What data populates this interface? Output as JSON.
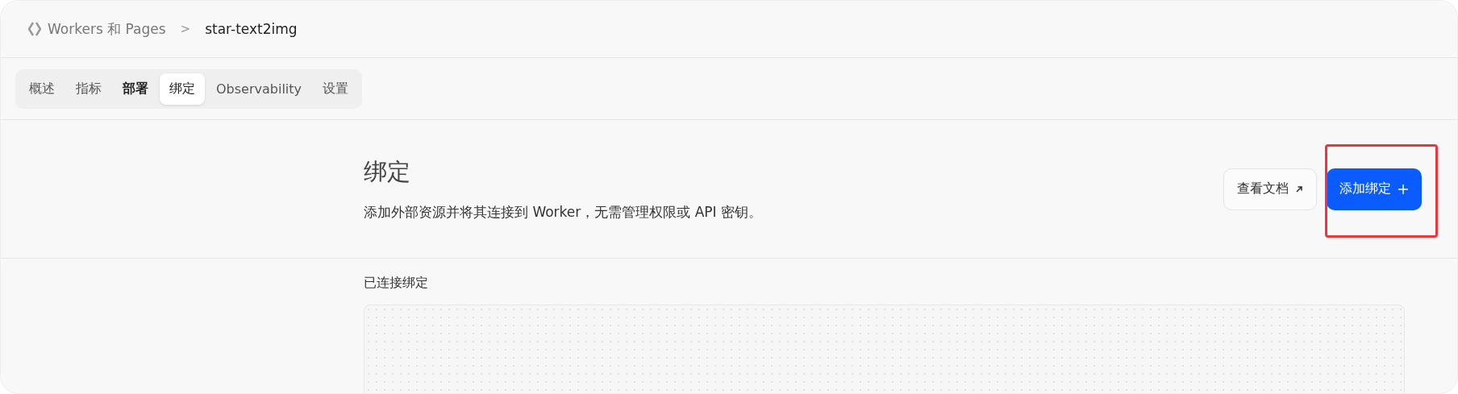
{
  "breadcrumb": {
    "parent": "Workers 和 Pages",
    "separator": ">",
    "current": "star-text2img"
  },
  "tabs": [
    {
      "label": "概述",
      "selected": false
    },
    {
      "label": "指标",
      "selected": false
    },
    {
      "label": "部署",
      "selected": false
    },
    {
      "label": "绑定",
      "selected": true
    },
    {
      "label": "Observability",
      "selected": false
    },
    {
      "label": "设置",
      "selected": false
    }
  ],
  "header": {
    "title": "绑定",
    "description": "添加外部资源并将其连接到 Worker，无需管理权限或 API 密钥。"
  },
  "buttons": [
    {
      "kind": "secondary",
      "label": "查看文档",
      "highlighted": false
    },
    {
      "kind": "primary",
      "label": "添加绑定",
      "highlighted": true
    }
  ],
  "connected": {
    "label": "已连接绑定"
  }
}
